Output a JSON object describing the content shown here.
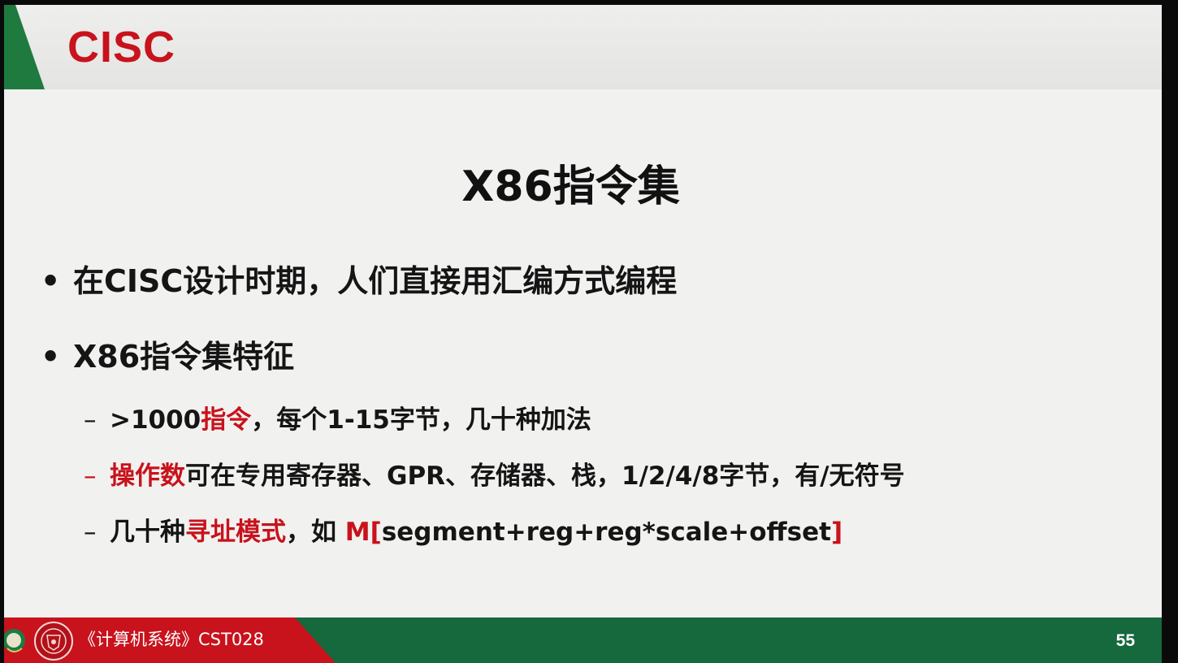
{
  "slide": {
    "heading": "CISC",
    "main_title": "X86指令集",
    "bullets": [
      {
        "text": "在CISC设计时期，人们直接用汇编方式编程"
      },
      {
        "text": "X86指令集特征"
      }
    ],
    "sub_items": [
      {
        "dash": "–",
        "parts": [
          ">1000",
          "指令",
          "，每个1-15字节，几十种加法"
        ]
      },
      {
        "dash": "–",
        "parts": [
          "操作数",
          "可在专用寄存器、GPR、存储器、栈，1/2/4/8字节，有/无符号"
        ]
      },
      {
        "dash": "–",
        "parts": [
          "几十种",
          "寻址模式",
          "，如 ",
          "M[",
          "segment+reg+reg*scale+offset",
          "]"
        ]
      }
    ],
    "bullet_marker": "•"
  },
  "footer": {
    "course_name": "《计算机系统》CST028",
    "page_number": "55"
  },
  "colors": {
    "accent_red": "#c8121c",
    "footer_green": "#16683d",
    "title_bar_green": "#1f7a3f"
  }
}
